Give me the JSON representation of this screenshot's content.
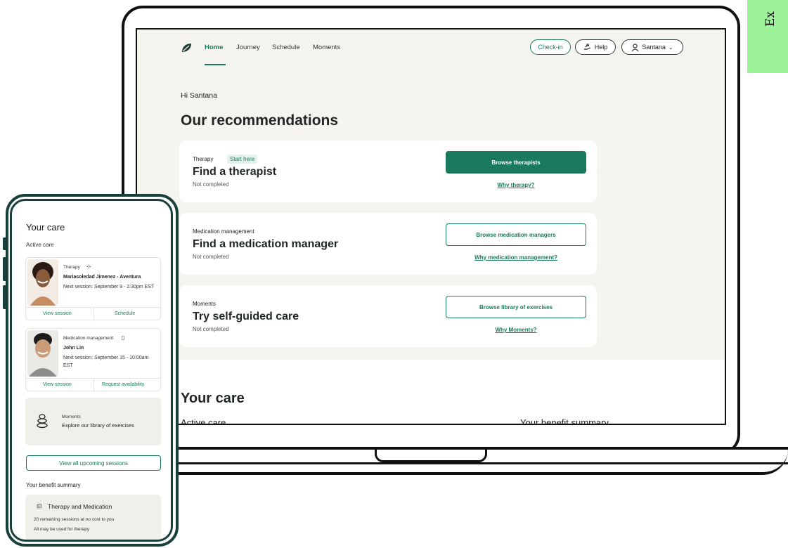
{
  "corner": {
    "text": "Ex"
  },
  "laptop": {
    "nav": {
      "links": [
        "Home",
        "Journey",
        "Schedule",
        "Moments"
      ],
      "active": "Home",
      "checkin_label": "Check-in",
      "help_label": "Help",
      "user_label": "Santana"
    },
    "greeting": "Hi Santana",
    "recommendations_heading": "Our recommendations",
    "cards": [
      {
        "category": "Therapy",
        "tag": "Start here",
        "title": "Find a therapist",
        "status": "Not completed",
        "button": "Browse therapists",
        "link": "Why therapy?"
      },
      {
        "category": "Medication management",
        "title": "Find a medication manager",
        "status": "Not completed",
        "button": "Browse medication managers",
        "link": "Why medication management?"
      },
      {
        "category": "Moments",
        "title": "Try self-guided care",
        "status": "Not completed",
        "button": "Browse library of exercises",
        "link": "Why Moments?"
      }
    ],
    "your_care_heading": "Your care",
    "clip_left": "Active care",
    "clip_right": "Your benefit summary"
  },
  "phone": {
    "title": "Your care",
    "active_care": "Active care",
    "care_cards": [
      {
        "category": "Therapy",
        "name": "Mariasoledad Jimenez - Aventura",
        "next": "Next session: September 9 - 2:30pm EST",
        "action_left": "View session",
        "action_right": "Schedule"
      },
      {
        "category": "Medication management",
        "name": "John Lin",
        "next": "Next session: September 15 - 10:00am EST",
        "action_left": "View session",
        "action_right": "Request availability"
      }
    ],
    "moments": {
      "category": "Moments",
      "label": "Explore our library of exercises"
    },
    "view_all_button": "View all upcoming sessions",
    "benefit_heading": "Your benefit summary",
    "benefit": {
      "title": "Therapy and Medication",
      "line1": "20 remaining sessions at no cost to you",
      "line2": "All may be used for therapy"
    }
  },
  "colors": {
    "accent": "#1a7a5e",
    "phone_frame": "#17403b",
    "badge": "#9ef39a",
    "screen_bg": "#f6f4ef"
  }
}
